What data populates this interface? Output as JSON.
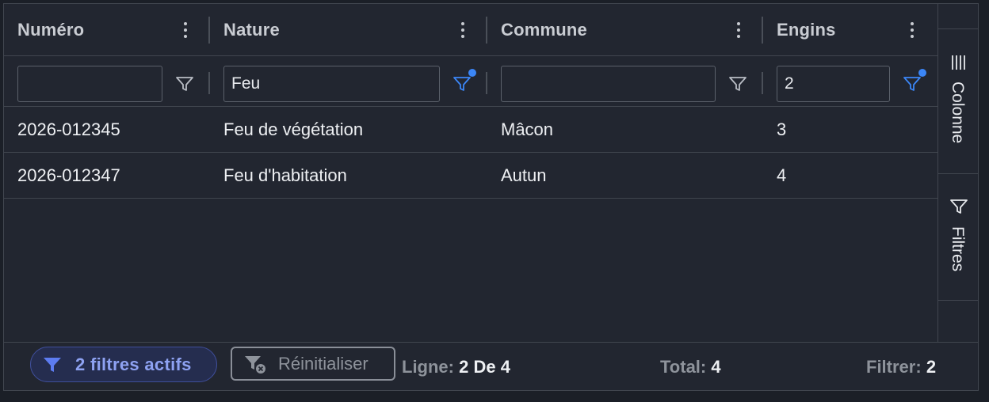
{
  "columns": [
    {
      "label": "Numéro"
    },
    {
      "label": "Nature"
    },
    {
      "label": "Commune"
    },
    {
      "label": "Engins"
    }
  ],
  "filters": {
    "numero": {
      "value": "",
      "active": false
    },
    "nature": {
      "value": "Feu",
      "active": true
    },
    "commune": {
      "value": "",
      "active": false
    },
    "engins": {
      "value": "2",
      "active": true
    }
  },
  "rows": [
    {
      "numero": "2026-012345",
      "nature": "Feu de végétation",
      "commune": "Mâcon",
      "engins": "3"
    },
    {
      "numero": "2026-012347",
      "nature": "Feu d'habitation",
      "commune": "Autun",
      "engins": "4"
    }
  ],
  "side_panel": {
    "columns_tab": "Colonne",
    "filters_tab": "Filtres"
  },
  "footer": {
    "active_filters_label": "2 filtres actifs",
    "reset_label": "Réinitialiser",
    "rows_label": "Ligne:",
    "rows_value": "2 De 4",
    "total_label": "Total:",
    "total_value": "4",
    "filtered_label": "Filtrer:",
    "filtered_value": "2"
  },
  "colors": {
    "background": "#222630",
    "border": "#41464f",
    "accent": "#3b86f7",
    "chip_text": "#8ea2f2",
    "chip_bg": "#252d4f"
  },
  "icons": {
    "column_menu": "kebab-icon",
    "filter": "filter-icon",
    "columns_panel": "columns-icon",
    "reset": "filter-clear-icon"
  }
}
